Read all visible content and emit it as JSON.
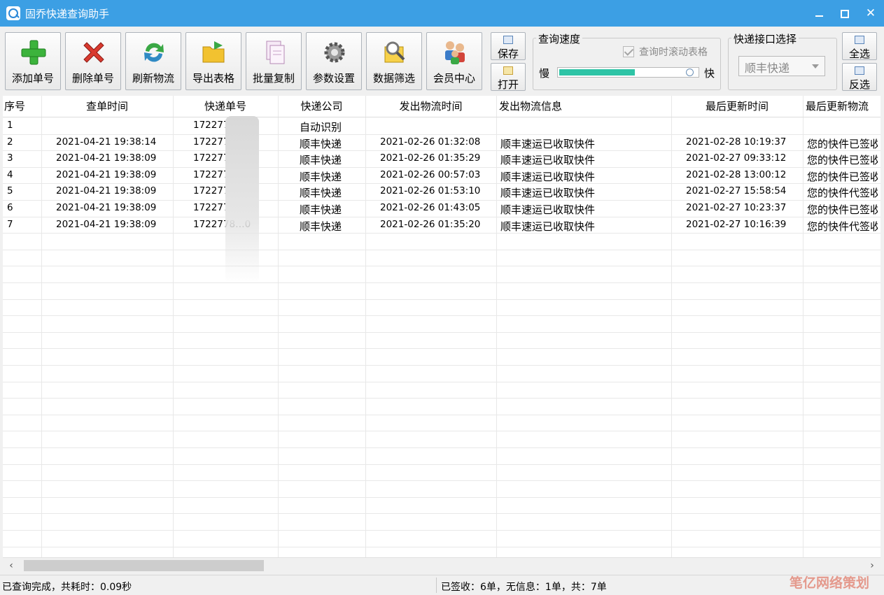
{
  "window": {
    "title": "固乔快递查询助手"
  },
  "toolbar": {
    "buttons": [
      {
        "label": "添加单号",
        "icon": "add-icon"
      },
      {
        "label": "删除单号",
        "icon": "delete-icon"
      },
      {
        "label": "刷新物流",
        "icon": "refresh-icon"
      },
      {
        "label": "导出表格",
        "icon": "export-folder-icon"
      },
      {
        "label": "批量复制",
        "icon": "copy-icon"
      },
      {
        "label": "参数设置",
        "icon": "gear-icon"
      },
      {
        "label": "数据筛选",
        "icon": "filter-search-icon"
      },
      {
        "label": "会员中心",
        "icon": "members-icon"
      }
    ],
    "save_label": "保存",
    "open_label": "打开",
    "select_all_label": "全选",
    "invert_label": "反选"
  },
  "speed": {
    "group_title": "查询速度",
    "scroll_label": "查询时滚动表格",
    "scroll_checked": true,
    "slow_label": "慢",
    "fast_label": "快",
    "level": 0.55
  },
  "api": {
    "group_title": "快递接口选择",
    "selected": "顺丰快递"
  },
  "table": {
    "columns": [
      "序号",
      "查单时间",
      "快递单号",
      "快递公司",
      "发出物流时间",
      "发出物流信息",
      "最后更新时间",
      "最后更新物流"
    ],
    "rows": [
      [
        "1",
        "",
        "1722770…7",
        "自动识别",
        "",
        "",
        "",
        ""
      ],
      [
        "2",
        "2021-04-21 19:38:14",
        "1722770…5",
        "顺丰快递",
        "2021-02-26 01:32:08",
        "顺丰速运已收取快件",
        "2021-02-28 10:19:37",
        "您的快件已签收"
      ],
      [
        "3",
        "2021-04-21 19:38:09",
        "1722778…",
        "顺丰快递",
        "2021-02-26 01:35:29",
        "顺丰速运已收取快件",
        "2021-02-27 09:33:12",
        "您的快件已签收"
      ],
      [
        "4",
        "2021-04-21 19:38:09",
        "1722778…2",
        "顺丰快递",
        "2021-02-26 00:57:03",
        "顺丰速运已收取快件",
        "2021-02-28 13:00:12",
        "您的快件已签收"
      ],
      [
        "5",
        "2021-04-21 19:38:09",
        "1722778…",
        "顺丰快递",
        "2021-02-26 01:53:10",
        "顺丰速运已收取快件",
        "2021-02-27 15:58:54",
        "您的快件代签收"
      ],
      [
        "6",
        "2021-04-21 19:38:09",
        "1722778…0",
        "顺丰快递",
        "2021-02-26 01:43:05",
        "顺丰速运已收取快件",
        "2021-02-27 10:23:37",
        "您的快件已签收"
      ],
      [
        "7",
        "2021-04-21 19:38:09",
        "1722778…0",
        "顺丰快递",
        "2021-02-26 01:35:20",
        "顺丰速运已收取快件",
        "2021-02-27 10:16:39",
        "您的快件代签收"
      ]
    ]
  },
  "status": {
    "left": "已查询完成，共耗时：0.09秒",
    "right": "已签收：6单，无信息：1单，共：7单"
  },
  "watermark": "笔亿网络策划"
}
